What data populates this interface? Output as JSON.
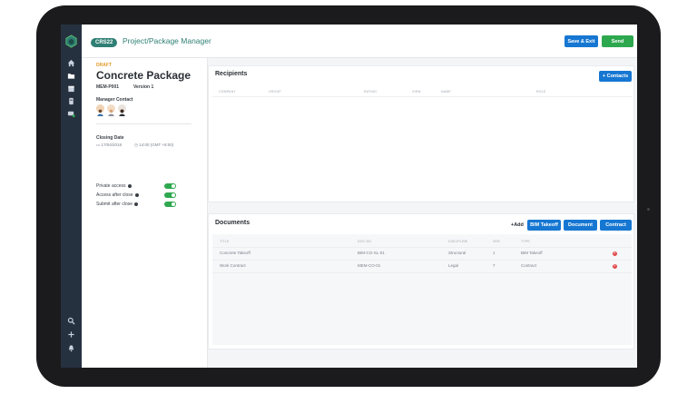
{
  "header": {
    "project_code": "CRS22",
    "app_title": "Project/Package Manager",
    "save_exit_label": "Save & Exit",
    "send_label": "Send"
  },
  "package": {
    "status": "DRAFT",
    "name": "Concrete Package",
    "code": "MEM-P001",
    "version": "Version 1",
    "manager_contact_label": "Manager Contact",
    "closing_date_label": "Closing Date",
    "closing_date": "17/04/2018",
    "closing_time": "14:00 (GMT +8:00)",
    "toggles": [
      {
        "label": "Private access",
        "on": true
      },
      {
        "label": "Access after close",
        "on": true
      },
      {
        "label": "Submit after close",
        "on": true
      }
    ]
  },
  "recipients": {
    "title": "Recipients",
    "add_contacts_label": "+ Contacts",
    "columns": [
      "COMPANY",
      "GROUP",
      "RATING",
      "VIEW",
      "NAME",
      "ROLE"
    ]
  },
  "documents": {
    "title": "Documents",
    "add_label": "+Add",
    "bim_takeoff_label": "BIM Takeoff",
    "document_label": "Document",
    "contract_label": "Contract",
    "columns": [
      "TITLE",
      "DOC NO",
      "DISCIPLINE",
      "VER",
      "TYPE"
    ],
    "rows": [
      {
        "title": "Concrete Takeoff",
        "doc_no": "BIM-CO-SL-01",
        "discipline": "Structural",
        "ver": "1",
        "type": "BIM Takeoff"
      },
      {
        "title": "Work Contract",
        "doc_no": "MEM-CO-01",
        "discipline": "Legal",
        "ver": "7",
        "type": "Contract"
      }
    ]
  },
  "colors": {
    "sidebar": "#263140",
    "brand_teal": "#2f7f74",
    "primary_blue": "#1677d2",
    "send_green": "#2ea84f",
    "draft_orange": "#e39a2b",
    "remove_red": "#e04848"
  },
  "icons": {
    "sidebar_top": [
      "home-icon",
      "folder-icon",
      "calendar-icon",
      "box-icon",
      "chat-icon"
    ],
    "sidebar_bottom": [
      "search-icon",
      "add-icon",
      "bell-icon"
    ]
  }
}
